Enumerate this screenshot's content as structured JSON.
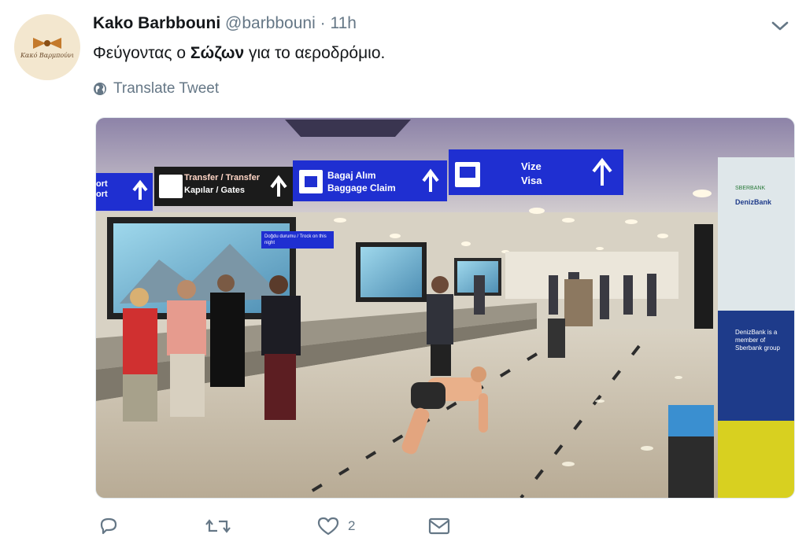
{
  "tweet": {
    "author_name": "Kako Barbbouni",
    "handle": "@barbbouni",
    "separator": "·",
    "time": "11h",
    "text_before": "Φεύγοντας ο ",
    "text_bold": "Σώζων",
    "text_after": " για το αεροδρόμιο.",
    "translate_label": "Translate Tweet",
    "avatar_lettering": "Κακό Βαρμπούνι",
    "likes_count": "2"
  },
  "photo": {
    "signs": {
      "left_partial": "ort\nort",
      "transfer_line1": "Transfer / Transfer",
      "transfer_line2": "Kapılar / Gates",
      "baggage_line1": "Bagaj Alım",
      "baggage_line2": "Baggage Claim",
      "visa_line1": "Vize",
      "visa_line2": "Visa",
      "small_sign": "Doğdu durumu / Trock on this night",
      "bank_name": "DenizBank",
      "bank_logo": "SBERBANK",
      "bank_ad": "DenizBank is a member of Sberbank group"
    }
  },
  "colors": {
    "sign_blue": "#1f2fd1",
    "sign_black": "#1b1b1b",
    "accent": "#1da1f2",
    "muted": "#657786"
  },
  "icons": {
    "reply": "reply-icon",
    "retweet": "retweet-icon",
    "like": "heart-icon",
    "dm": "envelope-icon",
    "globe": "globe-icon",
    "caret": "chevron-down-icon"
  }
}
